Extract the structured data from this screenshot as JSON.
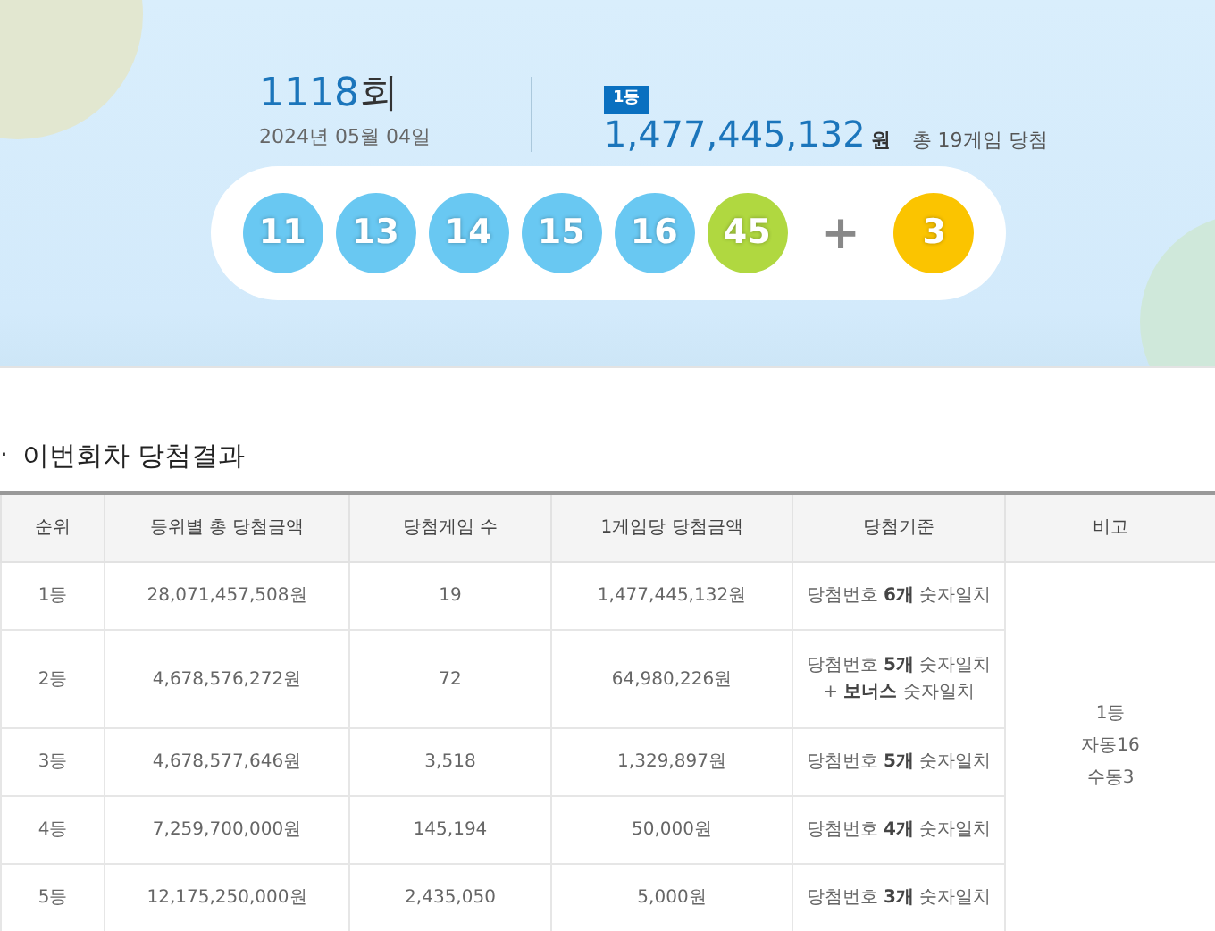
{
  "draw": {
    "round_number": "1118",
    "round_suffix": "회",
    "date": "2024년 05월 04일",
    "rank_badge": "1등",
    "prize": "1,477,445,132",
    "prize_unit": "원",
    "winners": "총 19게임 당첨",
    "balls": [
      {
        "number": "11",
        "color": "#69c8f2"
      },
      {
        "number": "13",
        "color": "#69c8f2"
      },
      {
        "number": "14",
        "color": "#69c8f2"
      },
      {
        "number": "15",
        "color": "#69c8f2"
      },
      {
        "number": "16",
        "color": "#69c8f2"
      },
      {
        "number": "45",
        "color": "#b0d840"
      }
    ],
    "plus": "+",
    "bonus": {
      "number": "3",
      "color": "#fbc400"
    }
  },
  "results": {
    "bullet": "·",
    "title": "이번회차 당첨결과",
    "columns": [
      "순위",
      "등위별 총 당첨금액",
      "당첨게임 수",
      "1게임당 당첨금액",
      "당첨기준",
      "비고"
    ],
    "rows": [
      {
        "rank": "1등",
        "total": "28,071,457,508원",
        "games": "19",
        "per_game": "1,477,445,132원",
        "criteria": "당첨번호 **6개** 숫자일치"
      },
      {
        "rank": "2등",
        "total": "4,678,576,272원",
        "games": "72",
        "per_game": "64,980,226원",
        "criteria": "당첨번호 **5개** 숫자일치\n+ **보너스** 숫자일치"
      },
      {
        "rank": "3등",
        "total": "4,678,577,646원",
        "games": "3,518",
        "per_game": "1,329,897원",
        "criteria": "당첨번호 **5개** 숫자일치"
      },
      {
        "rank": "4등",
        "total": "7,259,700,000원",
        "games": "145,194",
        "per_game": "50,000원",
        "criteria": "당첨번호 **4개** 숫자일치"
      },
      {
        "rank": "5등",
        "total": "12,175,250,000원",
        "games": "2,435,050",
        "per_game": "5,000원",
        "criteria": "당첨번호 **3개** 숫자일치"
      }
    ],
    "remarks": [
      "1등",
      "자동16",
      "수동3"
    ]
  }
}
